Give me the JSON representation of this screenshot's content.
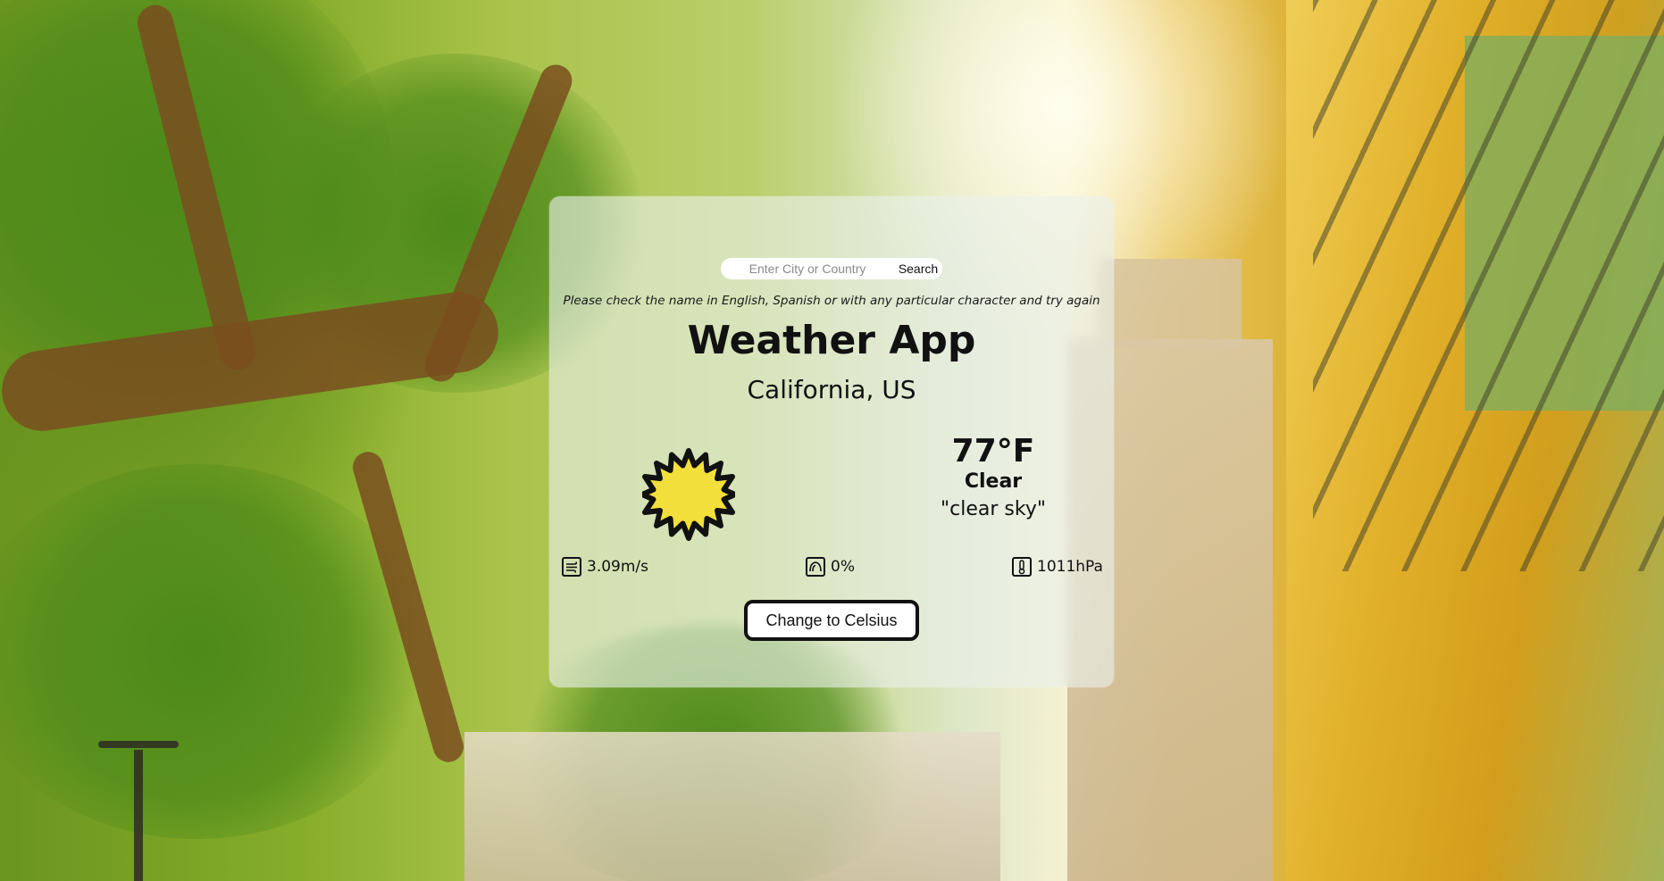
{
  "search": {
    "placeholder": "Enter City or Country",
    "button_label": "Search"
  },
  "hint": "Please check the name in English, Spanish or with any particular character and try again",
  "title": "Weather App",
  "location": "California, US",
  "weather": {
    "icon": "sun-icon",
    "temperature": "77°F",
    "condition": "Clear",
    "description": "\"clear sky\""
  },
  "stats": {
    "wind": {
      "icon": "wind-icon",
      "value": "3.09m/s"
    },
    "humidity": {
      "icon": "humidity-icon",
      "value": "0%"
    },
    "pressure": {
      "icon": "thermometer-icon",
      "value": "1011hPa"
    }
  },
  "toggle": {
    "label": "Change to Celsius"
  },
  "colors": {
    "sun_fill": "#f3df3c",
    "sun_stroke": "#111111",
    "card_bg": "#eaf0ec"
  }
}
